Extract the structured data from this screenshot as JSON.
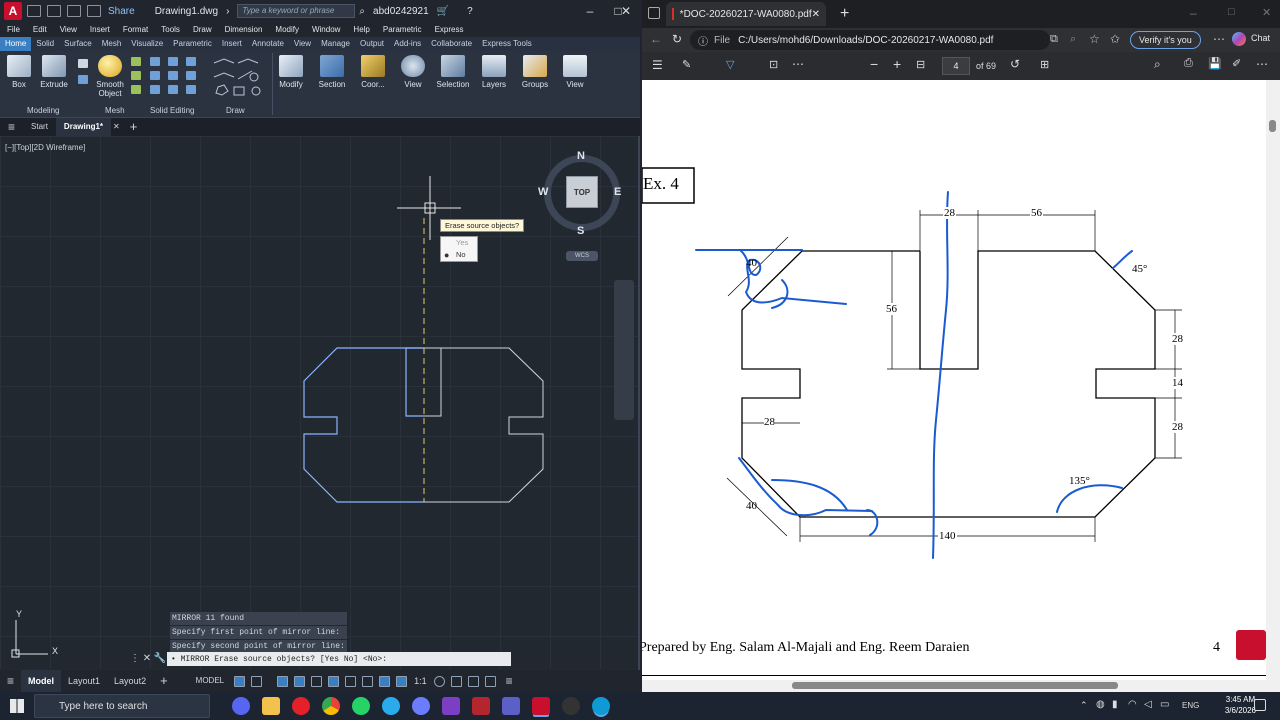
{
  "acad": {
    "app_icon": "A",
    "share": "Share",
    "file_name": "Drawing1.dwg",
    "search_placeholder": "Type a keyword or phrase",
    "user": "abd0242921",
    "menu": [
      "File",
      "Edit",
      "View",
      "Insert",
      "Format",
      "Tools",
      "Draw",
      "Dimension",
      "Modify",
      "Window",
      "Help",
      "Parametric",
      "Express"
    ],
    "ribbon_tabs": [
      "Home",
      "Solid",
      "Surface",
      "Mesh",
      "Visualize",
      "Parametric",
      "Insert",
      "Annotate",
      "View",
      "Manage",
      "Output",
      "Add-ins",
      "Collaborate",
      "Express Tools"
    ],
    "active_ribbon_tab": "Home",
    "ribbon": {
      "box": "Box",
      "extrude": "Extrude",
      "smooth_object_1": "Smooth",
      "smooth_object_2": "Object",
      "modify": "Modify",
      "section": "Section",
      "coordinates": "Coor...",
      "view": "View",
      "selection": "Selection",
      "layers": "Layers",
      "groups": "Groups",
      "view2": "View",
      "panel_modeling": "Modeling",
      "panel_mesh": "Mesh",
      "panel_solid_editing": "Solid Editing",
      "panel_draw": "Draw"
    },
    "file_tabs": [
      "Start",
      "Drawing1*"
    ],
    "viewport_label": "[−][Top][2D Wireframe]",
    "viewcube": {
      "n": "N",
      "s": "S",
      "e": "E",
      "w": "W",
      "top": "TOP",
      "wcs": "WCS"
    },
    "tooltip": "Erase source objects?",
    "tooltip_options": [
      "Yes",
      "No"
    ],
    "tooltip_selected": "No",
    "command_history": [
      "MIRROR 11 found",
      "Specify first point of mirror line:",
      "Specify second point of mirror line:"
    ],
    "command_line": "• MIRROR Erase source objects? [Yes No] <No>:",
    "layout_tabs": [
      "Model",
      "Layout1",
      "Layout2"
    ],
    "status_model": "MODEL",
    "scale": "1:1",
    "ucs_y": "Y",
    "ucs_x": "X",
    "colors": {
      "accent": "#3a7fc1",
      "shape": "#8ab4ff",
      "mirror_line": "#e8c86a"
    }
  },
  "edge": {
    "tab_title": "*DOC-20260217-WA0080.pdf",
    "url_prefix": "File",
    "url": "C:/Users/mohd6/Downloads/DOC-20260217-WA0080.pdf",
    "verify": "Verify it's you",
    "chat": "Chat",
    "page": "4",
    "page_total": "of 69"
  },
  "pdf": {
    "title": "Ex. 4",
    "dims": {
      "d28_top": "28",
      "d56_top": "56",
      "d40_tl": "40",
      "d45": "45°",
      "d56_left": "56",
      "d28_r1": "28",
      "d14": "14",
      "d28_r2": "28",
      "d28_left": "28",
      "d40_bl": "40",
      "d135": "135°",
      "d140": "140"
    },
    "footer": "Prepared by Eng. Salam Al-Majali and Eng. Reem Daraien",
    "page_num": "4"
  },
  "taskbar": {
    "search": "Type here to search",
    "lang": "ENG",
    "time": "3:45 AM",
    "date": "3/6/2026"
  }
}
